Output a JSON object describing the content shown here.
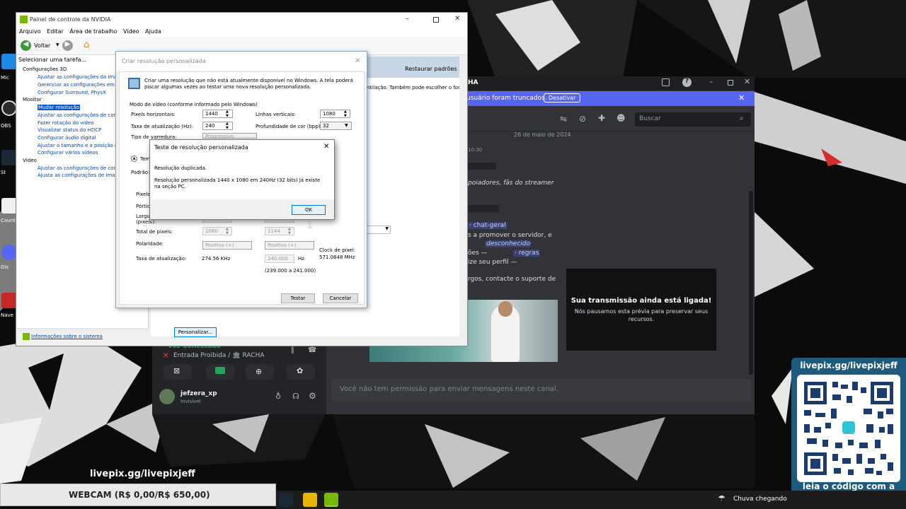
{
  "desktop": {
    "icons": [
      {
        "label": "Mic",
        "color": "#1e88e5"
      },
      {
        "label": "OBS",
        "color": "#2b2b2b"
      },
      {
        "label": "St",
        "color": "#1b2838"
      },
      {
        "label": "Count",
        "color": "#f0f0f0"
      },
      {
        "label": "Dis",
        "color": "#5865f2"
      },
      {
        "label": "Nave",
        "color": "#c62828"
      }
    ]
  },
  "discord": {
    "title": "HA",
    "banner_text": "usuário foram truncados.",
    "banner_button": "Desativar",
    "search_placeholder": "Buscar",
    "date_divider": "26 de maio de 2024",
    "time": "10:30",
    "msg_line1": "poiadores, fãs do streamer",
    "chip_channel": "· chat-geral",
    "msg_line2": "s a promover o servidor, e",
    "chip_unknown": "desconhecido",
    "msg_line3": "ões —",
    "chip_rules": "· regras",
    "msg_line4": "ize seu perfil —",
    "msg_line5": "rgos, contacte o suporte de",
    "stream_title": "Sua transmissão ainda está ligada!",
    "stream_sub": "Nós pausamos esta prévia para preservar seus recursos.",
    "voice_status": "Voz Conectada",
    "voice_channel": "Entrada Proibida / 🏛 RACHA",
    "user_name": "jefzera_xp",
    "user_status": "Invisível",
    "message_placeholder": "Você não tem permissão para enviar mensagens neste canal."
  },
  "nvcp": {
    "title": "Painel de controle da NVIDIA",
    "menu": [
      "Arquivo",
      "Editar",
      "Área de trabalho",
      "Vídeo",
      "Ajuda"
    ],
    "back": "Voltar",
    "task_label": "Selecionar uma tarefa...",
    "tree": {
      "g1": "Configurações 3D",
      "g1_items": [
        "Ajustar as configurações da image",
        "Gerenciar as configurações em 3D",
        "Configurar Surround, PhysX"
      ],
      "g2": "Monitor",
      "g2_items": [
        "Mudar resolução",
        "Ajustar as configurações de cor da",
        "Fazer rotação do vídeo",
        "Visualizar status do HDCP",
        "Configurar áudio digital",
        "Ajustar o tamanho e a posição da",
        "Configurar vários vídeos"
      ],
      "g3": "Vídeo",
      "g3_items": [
        "Ajustar as configurações de cor de",
        "Ajusta as configurações de imagem"
      ]
    },
    "system_info": "Informações sobre o sistema",
    "restore_defaults": "Restaurar padrões",
    "right_text": "ntilação. Também pode escolher o form",
    "customize": "Personalizar..."
  },
  "custom_res": {
    "title": "Criar resolução personalizada",
    "intro": "Criar uma resolução que não está atualmente disponível no Windows. A tela poderá piscar algumas vezes ao testar uma nova resolução personalizada.",
    "group_label": "Modo de vídeo (conforme informado pelo Windows)",
    "h_pixels_label": "Pixels horizontais:",
    "h_pixels": "1440",
    "v_lines_label": "Linhas verticais:",
    "v_lines": "1080",
    "refresh_label": "Taxa de atualização (Hz):",
    "refresh": "240",
    "depth_label": "Profundidade de cor (bpp):",
    "depth": "32",
    "scan_label": "Tipo de varredura:",
    "scan": "Progressivo",
    "timing_label": "Tem",
    "standard_label": "Padrão:",
    "pixels_label": "Pixels",
    "porch_label": "Pórtic",
    "width_label": "Largu (pixels):",
    "total_pixels_label": "Total de pixels:",
    "total_h": "2080",
    "total_v": "1144",
    "polarity_label": "Polaridade:",
    "polarity_h": "Positivo (+)",
    "polarity_v": "Positivo (+)",
    "refresh_rate_label": "Taxa de atualização:",
    "refresh_khz": "274.56 KHz",
    "refresh_hz": "240.000",
    "hz_unit": "Hz",
    "hz_range": "(239.000 a 241.000)",
    "pixel_clock_label": "Clock de pixel:",
    "pixel_clock": "571.0848 MHz",
    "test_button": "Testar",
    "cancel_button": "Cancelar"
  },
  "alert": {
    "title": "Teste de resolução personalizada",
    "line1": "Resolução duplicada.",
    "line2": "Resolução personalizada 1440 x 1080 em 240Hz (32 bits) já existe na seção PC.",
    "ok": "OK"
  },
  "overlay": {
    "qr_title": "livepix.gg/livepixjeff",
    "qr_caption": "leia o código com a câmera do celular.",
    "livepix_text": "livepix.gg/livepixjeff",
    "webcam": "WEBCAM (R$ 0,00/R$ 650,00)"
  },
  "taskbar": {
    "weather": "Chuva chegando"
  },
  "colors": {
    "discord_blurple": "#5865f2",
    "nvidia_green": "#76b900",
    "qr_blue": "#1d5a7e"
  }
}
